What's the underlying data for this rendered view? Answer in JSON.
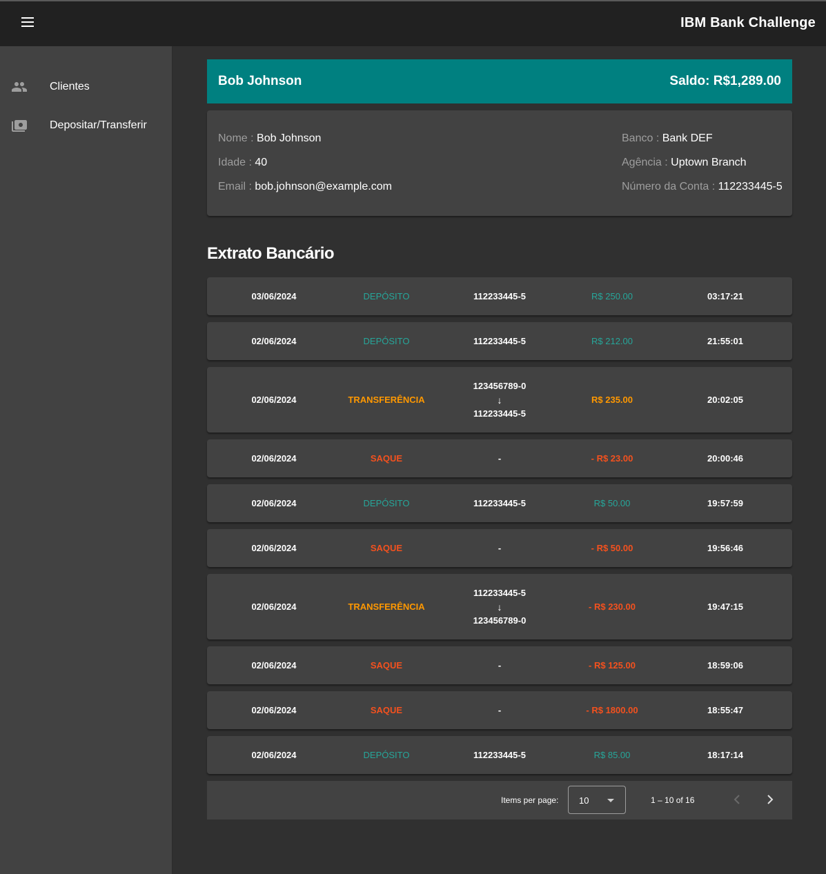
{
  "app": {
    "title": "IBM Bank Challenge"
  },
  "icons": {
    "menu": "menu-icon",
    "clients": "people-icon",
    "deposit": "local-atm-icon",
    "prev": "chevron-left-icon",
    "next": "chevron-right-icon"
  },
  "colors": {
    "accent": "#008080",
    "deposit": "#26a69a",
    "transfer": "#ff9800",
    "withdraw": "#f4511e"
  },
  "sidebar": {
    "items": [
      {
        "label": "Clientes"
      },
      {
        "label": "Depositar/Transferir"
      }
    ]
  },
  "client": {
    "name": "Bob Johnson",
    "balance": "Saldo: R$1,289.00",
    "fields": {
      "nome_label": "Nome : ",
      "nome": "Bob Johnson",
      "idade_label": "Idade : ",
      "idade": "40",
      "email_label": "Email : ",
      "email": "bob.johnson@example.com",
      "banco_label": "Banco : ",
      "banco": "Bank DEF",
      "agencia_label": "Agência : ",
      "agencia": "Uptown Branch",
      "conta_label": "Número da Conta : ",
      "conta": "112233445-5"
    }
  },
  "statement": {
    "title": "Extrato Bancário",
    "rows": [
      {
        "date": "03/06/2024",
        "type": "DEPÓSITO",
        "account": "112233445-5",
        "amount": "R$ 250.00",
        "time": "03:17:21"
      },
      {
        "date": "02/06/2024",
        "type": "DEPÓSITO",
        "account": "112233445-5",
        "amount": "R$ 212.00",
        "time": "21:55:01"
      },
      {
        "date": "02/06/2024",
        "type": "TRANSFERÊNCIA",
        "from": "123456789-0",
        "arrow": "↓",
        "to": "112233445-5",
        "amount": "R$ 235.00",
        "time": "20:02:05"
      },
      {
        "date": "02/06/2024",
        "type": "SAQUE",
        "account": "-",
        "amount": "- R$ 23.00",
        "time": "20:00:46"
      },
      {
        "date": "02/06/2024",
        "type": "DEPÓSITO",
        "account": "112233445-5",
        "amount": "R$ 50.00",
        "time": "19:57:59"
      },
      {
        "date": "02/06/2024",
        "type": "SAQUE",
        "account": "-",
        "amount": "- R$ 50.00",
        "time": "19:56:46"
      },
      {
        "date": "02/06/2024",
        "type": "TRANSFERÊNCIA",
        "from": "112233445-5",
        "arrow": "↓",
        "to": "123456789-0",
        "amount": "- R$ 230.00",
        "time": "19:47:15"
      },
      {
        "date": "02/06/2024",
        "type": "SAQUE",
        "account": "-",
        "amount": "- R$ 125.00",
        "time": "18:59:06"
      },
      {
        "date": "02/06/2024",
        "type": "SAQUE",
        "account": "-",
        "amount": "- R$ 1800.00",
        "time": "18:55:47"
      },
      {
        "date": "02/06/2024",
        "type": "DEPÓSITO",
        "account": "112233445-5",
        "amount": "R$ 85.00",
        "time": "18:17:14"
      }
    ]
  },
  "paginator": {
    "items_label": "Items per page:",
    "page_size": "10",
    "range": "1 – 10 of 16"
  }
}
